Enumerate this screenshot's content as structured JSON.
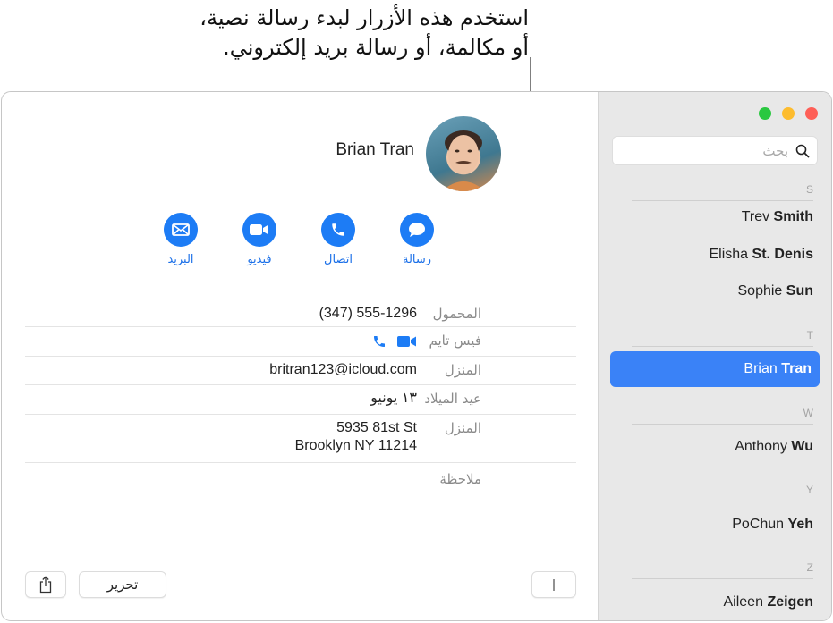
{
  "callout": {
    "lines": [
      "استخدم هذه الأزرار لبدء رسالة نصية،",
      "أو مكالمة، أو رسالة بريد إلكتروني."
    ]
  },
  "window": {
    "traffic_lights": {
      "zoom": "#2ac840",
      "minimize": "#fdbc2e",
      "close": "#fe5f57"
    },
    "search": {
      "placeholder": "بحث",
      "icon": "search-icon"
    }
  },
  "sidebar": {
    "sections": [
      {
        "letter": "S",
        "contacts": [
          {
            "first": "Trev",
            "last": "Smith"
          },
          {
            "first": "Elisha",
            "last": "St. Denis"
          },
          {
            "first": "Sophie",
            "last": "Sun"
          }
        ]
      },
      {
        "letter": "T",
        "contacts": [
          {
            "first": "Brian",
            "last": "Tran",
            "selected": true
          }
        ]
      },
      {
        "letter": "W",
        "contacts": [
          {
            "first": "Anthony",
            "last": "Wu"
          }
        ]
      },
      {
        "letter": "Y",
        "contacts": [
          {
            "first": "PoChun",
            "last": "Yeh"
          }
        ]
      },
      {
        "letter": "Z",
        "contacts": [
          {
            "first": "Aileen",
            "last": "Zeigen"
          }
        ]
      }
    ],
    "selected_color": "#3a82f7"
  },
  "contact": {
    "name": "Brian Tran",
    "actions": [
      {
        "label": "رسالة",
        "icon": "message-bubble-icon"
      },
      {
        "label": "اتصال",
        "icon": "phone-icon"
      },
      {
        "label": "فيديو",
        "icon": "video-camera-icon"
      },
      {
        "label": "البريد",
        "icon": "envelope-icon"
      }
    ],
    "accent": "#1d7cf5",
    "fields": [
      {
        "label": "المحمول",
        "value": "(347) 555-1296"
      },
      {
        "label": "فيس تايم",
        "value": "",
        "icons": [
          "video-camera-icon",
          "phone-icon"
        ]
      },
      {
        "label": "المنزل",
        "value": "britran123@icloud.com"
      },
      {
        "label": "عيد الميلاد",
        "value": "١٣ يونيو"
      },
      {
        "label": "المنزل",
        "value": "5935 81st St",
        "value2": "Brooklyn NY 11214"
      },
      {
        "label": "ملاحظة",
        "value": ""
      }
    ]
  },
  "toolbar": {
    "add_label": "+",
    "edit_label": "تحرير",
    "share_icon": "share-icon"
  }
}
